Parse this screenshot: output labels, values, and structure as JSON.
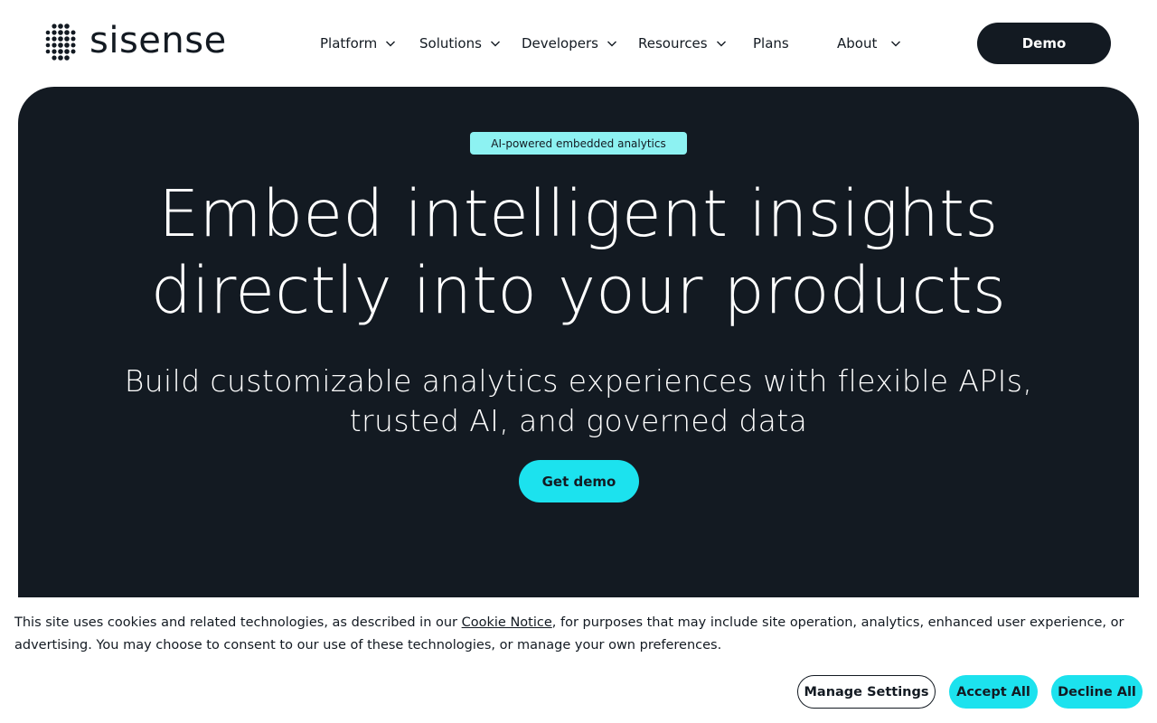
{
  "brand": {
    "name": "sisense",
    "dark_color": "#131a22",
    "accent_color": "#1ce2ee",
    "badge_color": "#8df2f2"
  },
  "nav": {
    "items": [
      {
        "label": "Platform",
        "has_dropdown": true
      },
      {
        "label": "Solutions",
        "has_dropdown": true
      },
      {
        "label": "Developers",
        "has_dropdown": true
      },
      {
        "label": "Resources",
        "has_dropdown": true
      },
      {
        "label": "Plans",
        "has_dropdown": false
      },
      {
        "label": "About",
        "has_dropdown": true
      }
    ],
    "cta_label": "Demo"
  },
  "hero": {
    "badge": "AI-powered embedded analytics",
    "title_line1": "Embed intelligent insights",
    "title_line2": "directly into your products",
    "subtitle_line1": "Build customizable analytics experiences with flexible APIs,",
    "subtitle_line2": "trusted AI, and governed data",
    "cta_label": "Get demo"
  },
  "cookie_banner": {
    "text_before_link": "This site uses cookies and related technologies, as described in our ",
    "link_text": "Cookie Notice",
    "text_after_link": ", for purposes that may include site operation, analytics, enhanced user experience, or advertising. You may choose to consent to our use of these technologies, or manage your own preferences.",
    "manage_label": "Manage Settings",
    "accept_label": "Accept All",
    "decline_label": "Decline All"
  }
}
